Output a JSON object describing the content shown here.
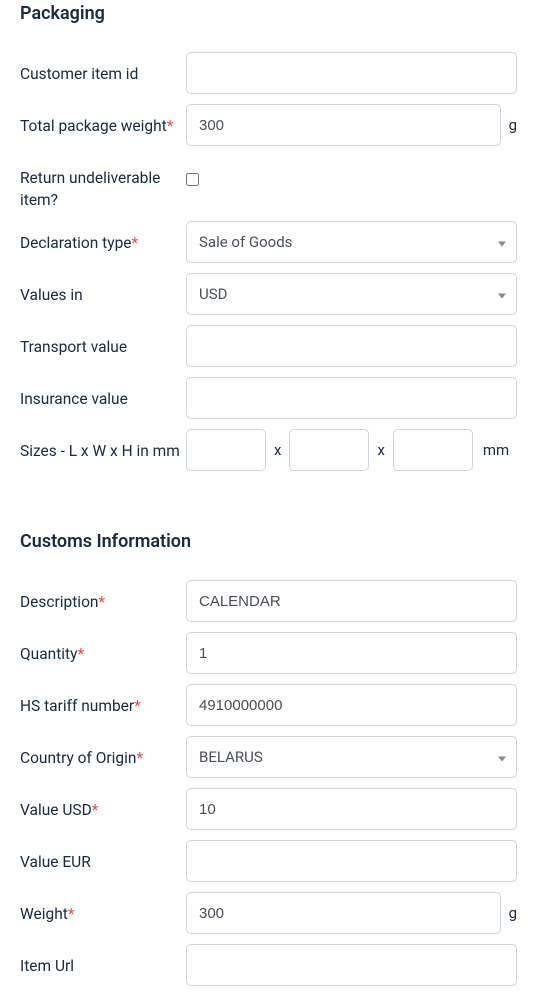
{
  "packaging": {
    "heading": "Packaging",
    "customer_item_id": {
      "label": "Customer item id",
      "value": ""
    },
    "total_package_weight": {
      "label": "Total package weight",
      "value": "300",
      "unit": "g"
    },
    "return_undeliverable": {
      "label": "Return undeliverable item?",
      "checked": false
    },
    "declaration_type": {
      "label": "Declaration type",
      "selected": "Sale of Goods"
    },
    "values_in": {
      "label": "Values in",
      "selected": "USD"
    },
    "transport_value": {
      "label": "Transport value",
      "value": ""
    },
    "insurance_value": {
      "label": "Insurance value",
      "value": ""
    },
    "sizes": {
      "label": "Sizes - L x W x H in mm",
      "length": "",
      "width": "",
      "height": "",
      "separator": "x",
      "unit": "mm"
    }
  },
  "customs": {
    "heading": "Customs Information",
    "description": {
      "label": "Description",
      "value": "CALENDAR"
    },
    "quantity": {
      "label": "Quantity",
      "value": "1"
    },
    "hs_tariff_number": {
      "label": "HS tariff number",
      "value": "4910000000"
    },
    "country_of_origin": {
      "label": "Country of Origin",
      "selected": "BELARUS"
    },
    "value_usd": {
      "label": "Value USD",
      "value": "10"
    },
    "value_eur": {
      "label": "Value EUR",
      "value": ""
    },
    "weight": {
      "label": "Weight",
      "value": "300",
      "unit": "g"
    },
    "item_url": {
      "label": "Item Url",
      "value": ""
    }
  },
  "required_marker": "*"
}
